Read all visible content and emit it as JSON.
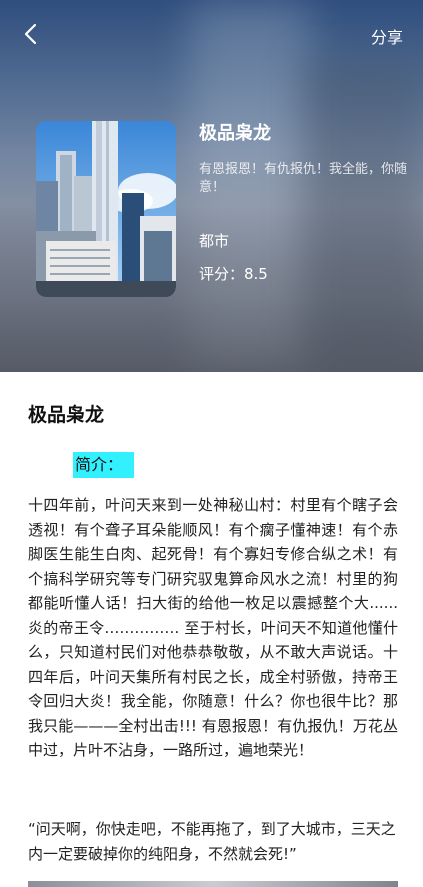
{
  "topbar": {
    "back_icon": "chevron-left-icon",
    "share_label": "分享"
  },
  "book": {
    "title": "极品枭龙",
    "tagline": "有恩报恩！有仇报仇！我全能，你随意！",
    "genre": "都市",
    "rating": "评分：8.5"
  },
  "content": {
    "title": "极品枭龙",
    "intro_label": "简介：",
    "synopsis": "十四年前，叶问天来到一处神秘山村：村里有个瞎子会透视！有个聋子耳朵能顺风！有个瘸子懂神速！有个赤脚医生能生白肉、起死骨！有个寡妇专修合纵之术！有个搞科学研究等专门研究驭鬼算命风水之流！村里的狗都能听懂人话！扫大街的给他一枚足以震撼整个大......炎的帝王令…………… 至于村长，叶问天不知道他懂什么，只知道村民们对他恭恭敬敬，从不敢大声说话。十四年后，叶问天集所有村民之长，成全村骄傲，持帝王令回归大炎！我全能，你随意！什么？你也很牛比？那我只能———全村出击!!! 有恩报恩！有仇报仇！万花丛中过，片叶不沾身，一路所过，遍地荣光！",
    "quote": "“问天啊，你快走吧，不能再拖了，到了大城市，三天之内一定要破掉你的纯阳身，不然就会死!”"
  },
  "colors": {
    "intro_highlight": "#33f0ff",
    "hero_top": "#2f4e7e",
    "hero_bottom": "#5c6270"
  }
}
